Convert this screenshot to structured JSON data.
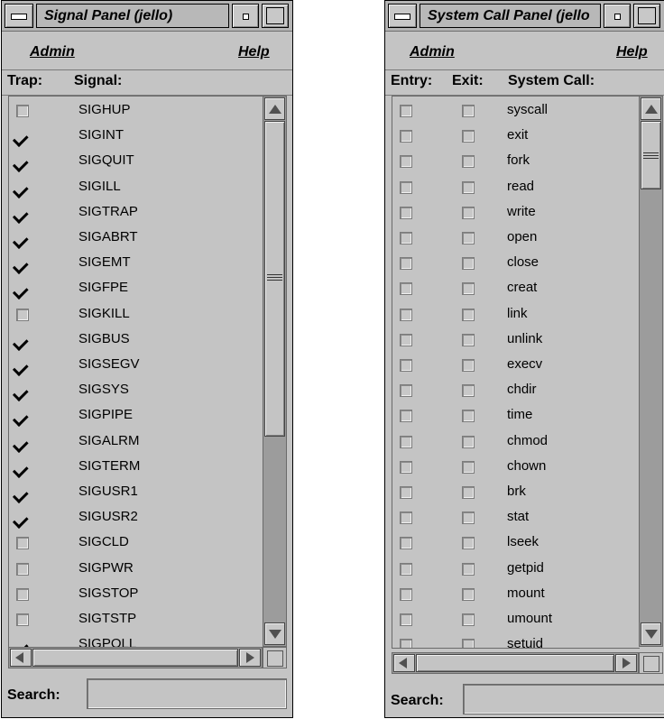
{
  "signal_panel": {
    "title": "Signal Panel (jello)",
    "menu": {
      "admin": "Admin",
      "help": "Help"
    },
    "headers": {
      "trap": "Trap:",
      "signal": "Signal:"
    },
    "rows": [
      {
        "label": "SIGHUP",
        "trap": false
      },
      {
        "label": "SIGINT",
        "trap": true
      },
      {
        "label": "SIGQUIT",
        "trap": true
      },
      {
        "label": "SIGILL",
        "trap": true
      },
      {
        "label": "SIGTRAP",
        "trap": true
      },
      {
        "label": "SIGABRT",
        "trap": true
      },
      {
        "label": "SIGEMT",
        "trap": true
      },
      {
        "label": "SIGFPE",
        "trap": true
      },
      {
        "label": "SIGKILL",
        "trap": false
      },
      {
        "label": "SIGBUS",
        "trap": true
      },
      {
        "label": "SIGSEGV",
        "trap": true
      },
      {
        "label": "SIGSYS",
        "trap": true
      },
      {
        "label": "SIGPIPE",
        "trap": true
      },
      {
        "label": "SIGALRM",
        "trap": true
      },
      {
        "label": "SIGTERM",
        "trap": true
      },
      {
        "label": "SIGUSR1",
        "trap": true
      },
      {
        "label": "SIGUSR2",
        "trap": true
      },
      {
        "label": "SIGCLD",
        "trap": false
      },
      {
        "label": "SIGPWR",
        "trap": false
      },
      {
        "label": "SIGSTOP",
        "trap": false
      },
      {
        "label": "SIGTSTP",
        "trap": false
      },
      {
        "label": "SIGPOLL",
        "trap": true
      }
    ],
    "search": {
      "label": "Search:",
      "value": ""
    }
  },
  "syscall_panel": {
    "title": "System Call Panel (jello",
    "menu": {
      "admin": "Admin",
      "help": "Help"
    },
    "headers": {
      "entry": "Entry:",
      "exit": "Exit:",
      "syscall": "System Call:"
    },
    "rows": [
      {
        "label": "syscall",
        "entry": false,
        "exit": false
      },
      {
        "label": "exit",
        "entry": false,
        "exit": false
      },
      {
        "label": "fork",
        "entry": false,
        "exit": false
      },
      {
        "label": "read",
        "entry": false,
        "exit": false
      },
      {
        "label": "write",
        "entry": false,
        "exit": false
      },
      {
        "label": "open",
        "entry": false,
        "exit": false
      },
      {
        "label": "close",
        "entry": false,
        "exit": false
      },
      {
        "label": "creat",
        "entry": false,
        "exit": false
      },
      {
        "label": "link",
        "entry": false,
        "exit": false
      },
      {
        "label": "unlink",
        "entry": false,
        "exit": false
      },
      {
        "label": "execv",
        "entry": false,
        "exit": false
      },
      {
        "label": "chdir",
        "entry": false,
        "exit": false
      },
      {
        "label": "time",
        "entry": false,
        "exit": false
      },
      {
        "label": "chmod",
        "entry": false,
        "exit": false
      },
      {
        "label": "chown",
        "entry": false,
        "exit": false
      },
      {
        "label": "brk",
        "entry": false,
        "exit": false
      },
      {
        "label": "stat",
        "entry": false,
        "exit": false
      },
      {
        "label": "lseek",
        "entry": false,
        "exit": false
      },
      {
        "label": "getpid",
        "entry": false,
        "exit": false
      },
      {
        "label": "mount",
        "entry": false,
        "exit": false
      },
      {
        "label": "umount",
        "entry": false,
        "exit": false
      },
      {
        "label": "setuid",
        "entry": false,
        "exit": false
      }
    ],
    "search": {
      "label": "Search:",
      "value": ""
    }
  }
}
